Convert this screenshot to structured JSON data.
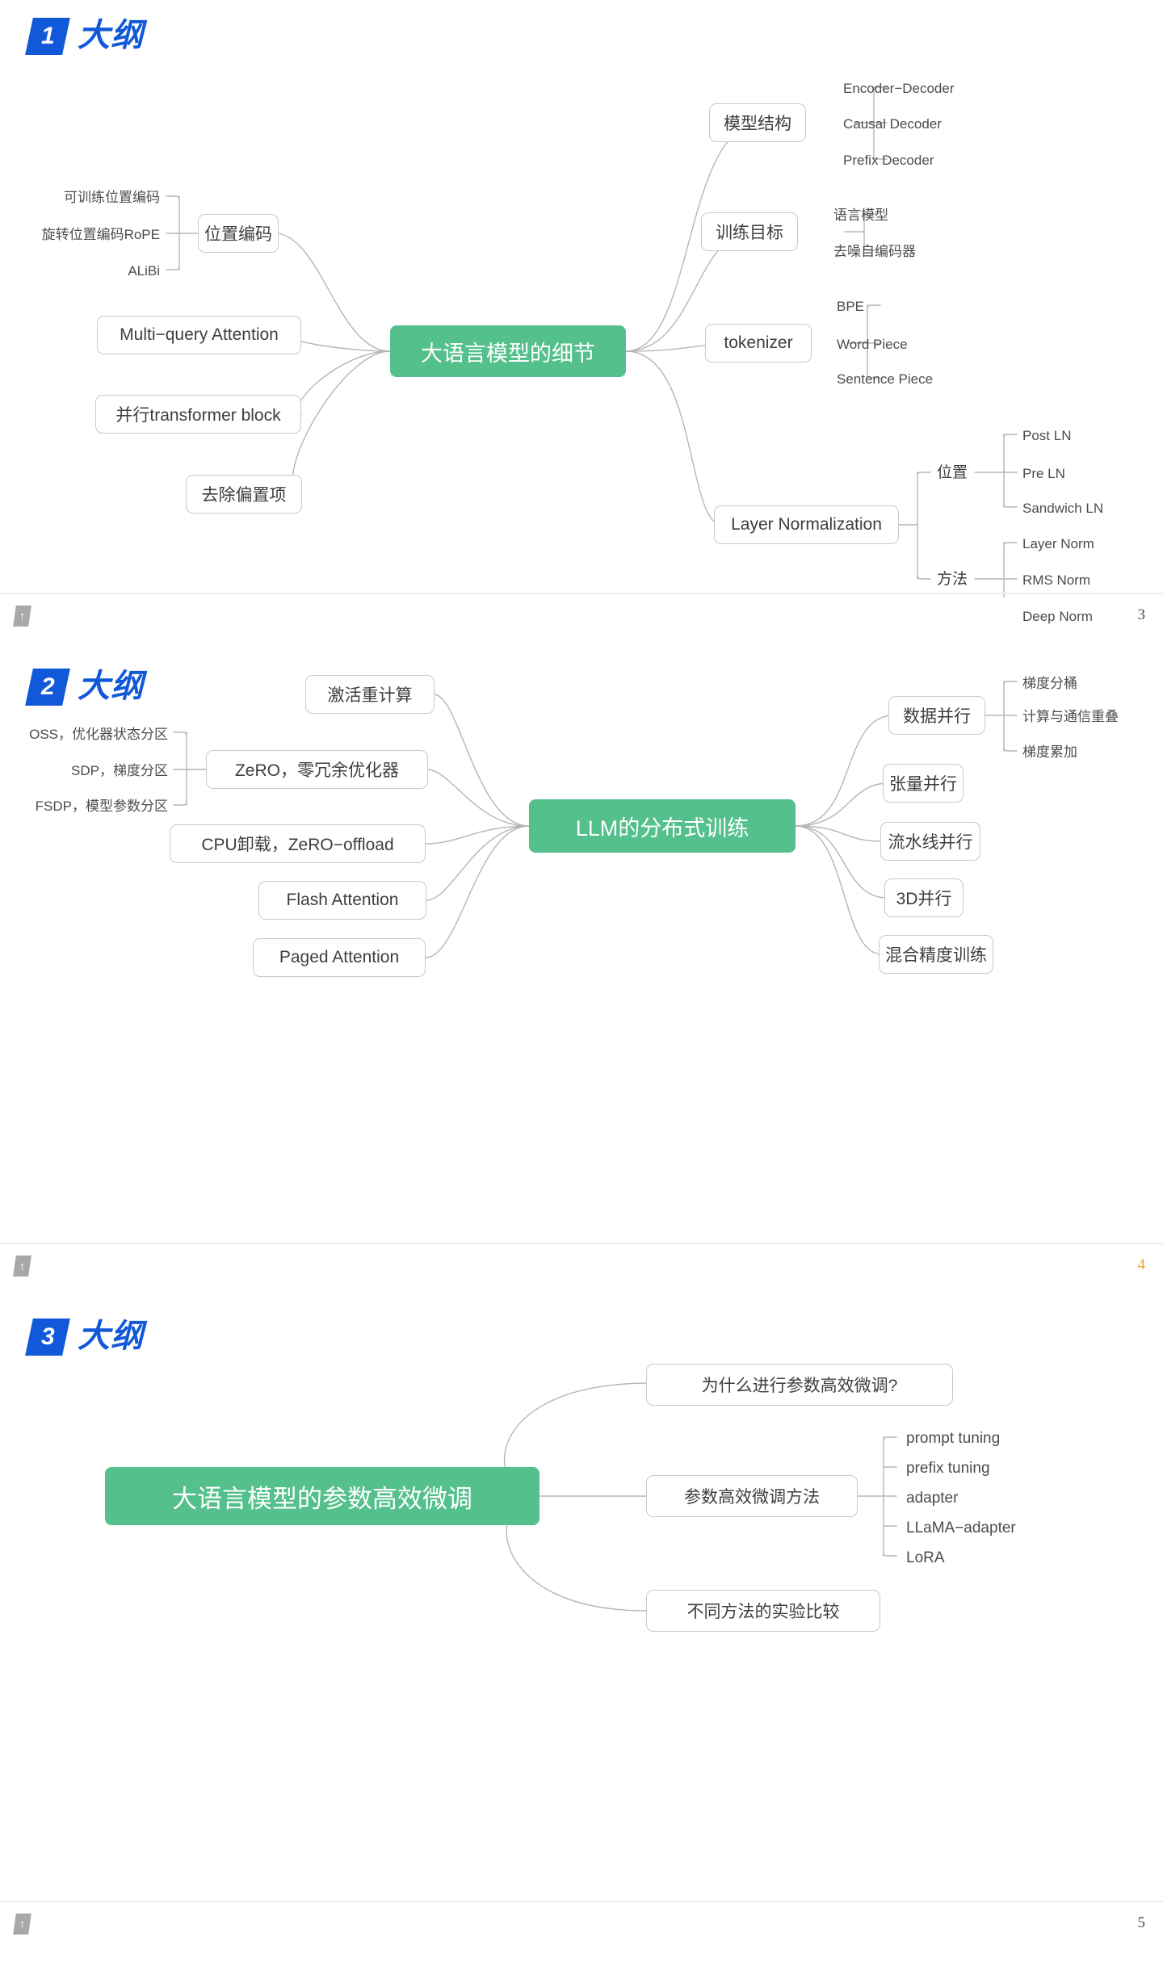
{
  "slides": [
    {
      "number": "1",
      "title": "大纲",
      "page": "3",
      "page_color": "#4a4a4a",
      "root": "大语言模型的细节",
      "root_color": "#54c08c",
      "left_branches": [
        {
          "label": "位置编码",
          "children": [
            "可训练位置编码",
            "旋转位置编码RoPE",
            "ALiBi"
          ]
        },
        {
          "label": "Multi−query Attention",
          "children": []
        },
        {
          "label": "并行transformer block",
          "children": []
        },
        {
          "label": "去除偏置项",
          "children": []
        }
      ],
      "right_branches": [
        {
          "label": "模型结构",
          "children": [
            "Encoder−Decoder",
            "Causal Decoder",
            "Prefix Decoder"
          ]
        },
        {
          "label": "训练目标",
          "children": [
            "语言模型",
            "去噪自编码器"
          ]
        },
        {
          "label": "tokenizer",
          "children": [
            "BPE",
            "Word Piece",
            "Sentence Piece"
          ]
        },
        {
          "label": "Layer Normalization",
          "groups": [
            {
              "label": "位置",
              "children": [
                "Post LN",
                "Pre LN",
                "Sandwich LN"
              ]
            },
            {
              "label": "方法",
              "children": [
                "Layer Norm",
                "RMS Norm",
                "Deep Norm"
              ]
            }
          ]
        }
      ]
    },
    {
      "number": "2",
      "title": "大纲",
      "page": "4",
      "page_color": "#e8a33d",
      "root": "LLM的分布式训练",
      "root_color": "#54c08c",
      "left_branches": [
        {
          "label": "激活重计算",
          "children": []
        },
        {
          "label": "ZeRO，零冗余优化器",
          "children": [
            "OSS，优化器状态分区",
            "SDP，梯度分区",
            "FSDP，模型参数分区"
          ]
        },
        {
          "label": "CPU卸载，ZeRO−offload",
          "children": []
        },
        {
          "label": "Flash Attention",
          "children": []
        },
        {
          "label": "Paged Attention",
          "children": []
        }
      ],
      "right_branches": [
        {
          "label": "数据并行",
          "children": [
            "梯度分桶",
            "计算与通信重叠",
            "梯度累加"
          ]
        },
        {
          "label": "张量并行",
          "children": []
        },
        {
          "label": "流水线并行",
          "children": []
        },
        {
          "label": "3D并行",
          "children": []
        },
        {
          "label": "混合精度训练",
          "children": []
        }
      ]
    },
    {
      "number": "3",
      "title": "大纲",
      "page": "5",
      "page_color": "#4a4a4a",
      "root": "大语言模型的参数高效微调",
      "root_color": "#54c08c",
      "left_branches": [],
      "right_branches": [
        {
          "label": "为什么进行参数高效微调?",
          "children": []
        },
        {
          "label": "参数高效微调方法",
          "children": [
            "prompt tuning",
            "prefix tuning",
            "adapter",
            "LLaMA−adapter",
            "LoRA"
          ]
        },
        {
          "label": "不同方法的实验比较",
          "children": []
        }
      ]
    }
  ],
  "footer_icon": "up-arrow-badge"
}
